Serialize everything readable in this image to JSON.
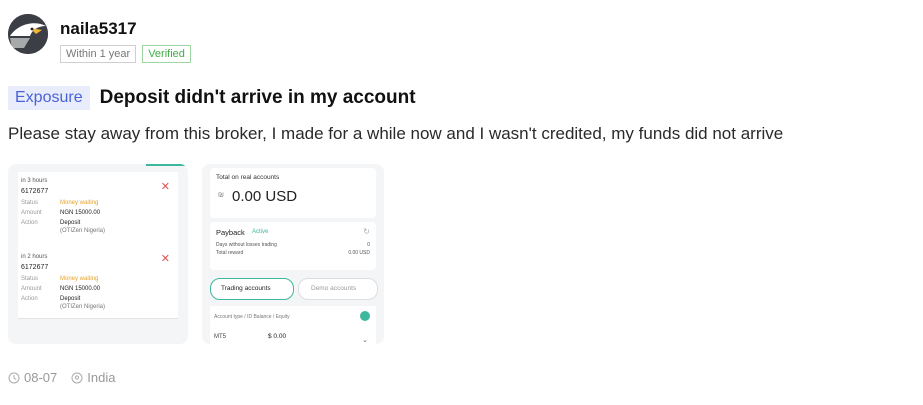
{
  "author": {
    "username": "naila5317",
    "tag_duration": "Within 1 year",
    "tag_verified": "Verified"
  },
  "post": {
    "badge": "Exposure",
    "title": "Deposit didn't arrive in my account",
    "body": "Please stay away from this broker, I made for a while now and I wasn't credited, my funds did not arrive"
  },
  "shot1": {
    "cards": [
      {
        "time": "in 3 hours",
        "id": "6172677",
        "status_label": "Status",
        "status_value": "Money waiting",
        "amount_label": "Amount",
        "amount_value": "NGN 15000.00",
        "action_label": "Action",
        "action_value": "Deposit",
        "action_sub": "(OTIZen Nigeria)"
      },
      {
        "time": "in 2 hours",
        "id": "6172677",
        "status_label": "Status",
        "status_value": "Money waiting",
        "amount_label": "Amount",
        "amount_value": "NGN 15000.00",
        "action_label": "Action",
        "action_value": "Deposit",
        "action_sub": "(OTIZen Nigeria)"
      }
    ]
  },
  "shot2": {
    "total_label": "Total on real accounts",
    "balance": "0.00 USD",
    "payback_label": "Payback",
    "payback_status": "Active",
    "days_label": "Days without losses trading",
    "days_value": "0",
    "reward_label": "Total reward",
    "reward_value": "0.00 USD",
    "tab_trading": "Trading accounts",
    "tab_demo": "Demo accounts",
    "columns": "Account type / ID   Balance / Equity",
    "row_type": "MT5",
    "row_balance": "$ 0.00"
  },
  "footer": {
    "date": "08-07",
    "location": "India"
  },
  "colors": {
    "badge_bg": "#e8ecfb",
    "badge_text": "#4a62d8",
    "verified": "#3fae48",
    "warning": "#e7a22a",
    "accent": "#3db89e"
  }
}
